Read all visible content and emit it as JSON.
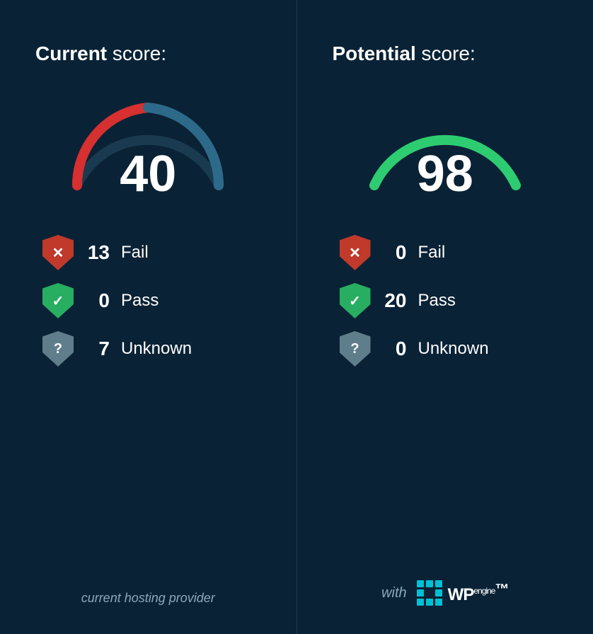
{
  "left": {
    "title_bold": "Current",
    "title_rest": " score:",
    "score": "40",
    "gauge_color_low": "#d63031",
    "gauge_color_high": "#2d6a8a",
    "stats": [
      {
        "type": "fail",
        "count": "13",
        "label": "Fail"
      },
      {
        "type": "pass",
        "count": "0",
        "label": "Pass"
      },
      {
        "type": "unknown",
        "count": "7",
        "label": "Unknown"
      }
    ],
    "footer": "current hosting provider"
  },
  "right": {
    "title_bold": "Potential",
    "title_rest": " score:",
    "score": "98",
    "gauge_color": "#2ecc71",
    "stats": [
      {
        "type": "fail",
        "count": "0",
        "label": "Fail"
      },
      {
        "type": "pass",
        "count": "20",
        "label": "Pass"
      },
      {
        "type": "unknown",
        "count": "0",
        "label": "Unknown"
      }
    ],
    "footer_with": "with",
    "footer_wp": "WP",
    "footer_engine": "engine",
    "footer_tm": "™"
  },
  "icons": {
    "fail": "✕",
    "pass": "✓",
    "unknown": "?"
  }
}
